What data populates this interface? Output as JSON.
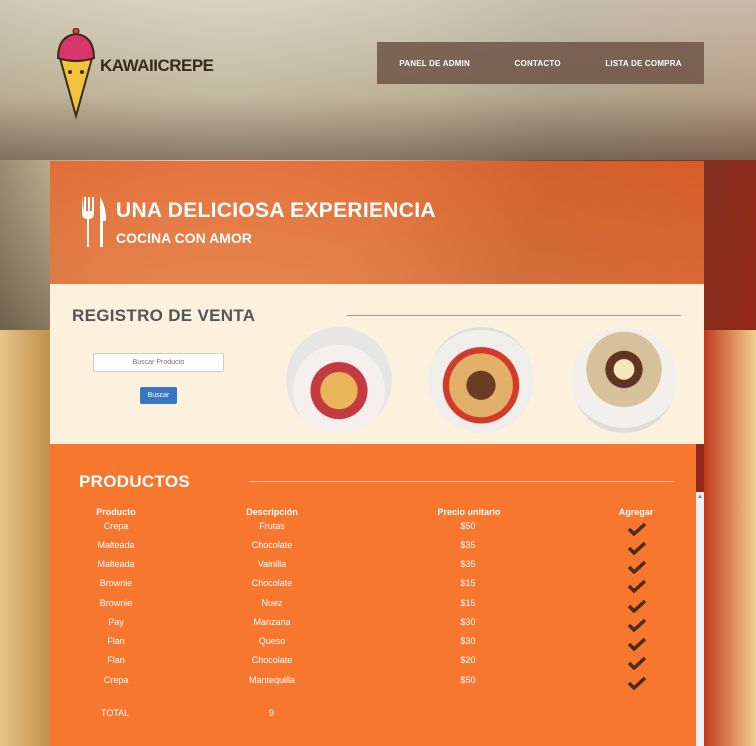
{
  "brand": {
    "name": "KAWAIICREPE"
  },
  "nav": [
    "PANEL DE ADMIN",
    "CONTACTO",
    "LISTA DE COMPRA"
  ],
  "hero": {
    "title": "UNA DELICIOSA EXPERIENCIA",
    "subtitle": "COCINA CON AMOR"
  },
  "registro": {
    "title": "REGISTRO DE VENTA",
    "search_placeholder": "Buscar Producto",
    "search_button": "Buscar"
  },
  "productos": {
    "title": "PRODUCTOS",
    "headers": [
      "Producto",
      "Descripción",
      "Precio unitario",
      "Agregar"
    ],
    "rows": [
      {
        "producto": "Crepa",
        "descripcion": "Frutas",
        "precio": "$50"
      },
      {
        "producto": "Malteada",
        "descripcion": "Chocolate",
        "precio": "$35"
      },
      {
        "producto": "Malteada",
        "descripcion": "Vainilla",
        "precio": "$35"
      },
      {
        "producto": "Brownie",
        "descripcion": "Chocolate",
        "precio": "$15"
      },
      {
        "producto": "Brownie",
        "descripcion": "Nuez",
        "precio": "$15"
      },
      {
        "producto": "Pay",
        "descripcion": "Manzana",
        "precio": "$30"
      },
      {
        "producto": "Flan",
        "descripcion": "Queso",
        "precio": "$30"
      },
      {
        "producto": "Flan",
        "descripcion": "Chocolate",
        "precio": "$20"
      },
      {
        "producto": "Crepa",
        "descripcion": "Mantequilla",
        "precio": "$50"
      }
    ],
    "total_label": "TOTAL",
    "total_value": "9"
  },
  "colors": {
    "accent": "#f7772f",
    "nav_bg": "#6e5546",
    "button_blue": "#3a75c4"
  },
  "icons": [
    "fork-knife-icon",
    "checkmark-icon"
  ]
}
